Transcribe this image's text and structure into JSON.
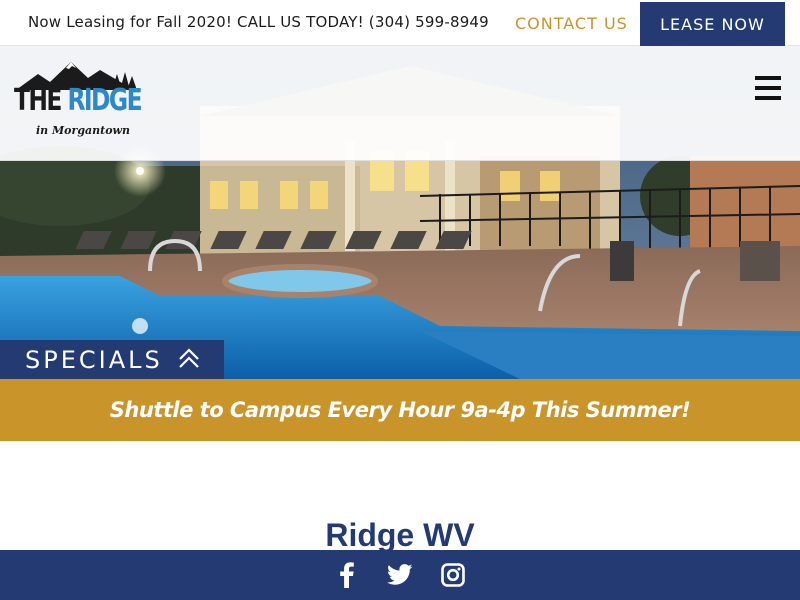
{
  "topbar": {
    "announcement": "Now Leasing for Fall 2020! CALL US TODAY! (304) 599-8949",
    "contact_label": "CONTACT US",
    "lease_label": "LEASE NOW"
  },
  "header": {
    "logo": {
      "line1_the": "THE",
      "line1_ridge": "RIDGE",
      "line2": "in Morgantown"
    },
    "menu_icon": "hamburger-menu-icon"
  },
  "hero": {
    "image": "pool-at-dusk-photo"
  },
  "specials": {
    "label": "SPECIALS",
    "icon": "double-chevron-up-icon"
  },
  "banner": {
    "text": "Shuttle to Campus Every Hour 9a-4p This Summer!"
  },
  "main": {
    "title": "Ridge WV"
  },
  "footer": {
    "social": [
      {
        "icon": "facebook-icon"
      },
      {
        "icon": "twitter-icon"
      },
      {
        "icon": "instagram-icon"
      }
    ]
  },
  "colors": {
    "navy": "#233a73",
    "gold": "#c9952b",
    "brand_blue": "#2d87c8"
  }
}
